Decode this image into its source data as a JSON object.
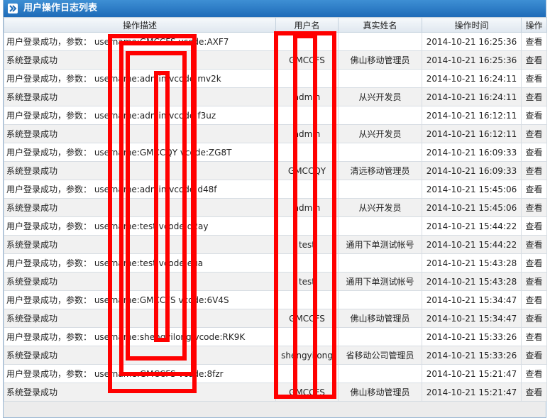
{
  "title": "用户操作日志列表",
  "columns": [
    "操作描述",
    "用户名",
    "真实姓名",
    "操作时间",
    "操作"
  ],
  "rows": [
    {
      "desc": "用户登录成功，参数： username:GMCCFS vcode:AXF7",
      "user": "",
      "name": "",
      "time": "2014-10-21 16:25:36",
      "action": "查看"
    },
    {
      "desc": "系统登录成功",
      "user": "GMCCFS",
      "name": "佛山移动管理员",
      "time": "2014-10-21 16:25:36",
      "action": "查看"
    },
    {
      "desc": "用户登录成功，参数： username:admin vcode:mv2k",
      "user": "",
      "name": "",
      "time": "2014-10-21 16:24:11",
      "action": "查看"
    },
    {
      "desc": "系统登录成功",
      "user": "admin",
      "name": "从兴开发员",
      "time": "2014-10-21 16:24:11",
      "action": "查看"
    },
    {
      "desc": "用户登录成功，参数： username:admin vcode:f3uz",
      "user": "",
      "name": "",
      "time": "2014-10-21 16:12:11",
      "action": "查看"
    },
    {
      "desc": "系统登录成功",
      "user": "admin",
      "name": "从兴开发员",
      "time": "2014-10-21 16:12:11",
      "action": "查看"
    },
    {
      "desc": "用户登录成功，参数： username:GMCCQY vcode:ZG8T",
      "user": "",
      "name": "",
      "time": "2014-10-21 16:09:33",
      "action": "查看"
    },
    {
      "desc": "系统登录成功",
      "user": "GMCCQY",
      "name": "清远移动管理员",
      "time": "2014-10-21 16:09:33",
      "action": "查看"
    },
    {
      "desc": "用户登录成功，参数： username:admin vcode:d48f",
      "user": "",
      "name": "",
      "time": "2014-10-21 15:45:06",
      "action": "查看"
    },
    {
      "desc": "系统登录成功",
      "user": "admin",
      "name": "从兴开发员",
      "time": "2014-10-21 15:45:06",
      "action": "查看"
    },
    {
      "desc": "用户登录成功，参数： username:test vcode:q2ay",
      "user": "",
      "name": "",
      "time": "2014-10-21 15:44:22",
      "action": "查看"
    },
    {
      "desc": "系统登录成功",
      "user": "test",
      "name": "通用下单测试帐号",
      "time": "2014-10-21 15:44:22",
      "action": "查看"
    },
    {
      "desc": "用户登录成功，参数： username:test vcode:eua",
      "user": "",
      "name": "",
      "time": "2014-10-21 15:43:28",
      "action": "查看"
    },
    {
      "desc": "系统登录成功",
      "user": "test",
      "name": "通用下单测试帐号",
      "time": "2014-10-21 15:43:28",
      "action": "查看"
    },
    {
      "desc": "用户登录成功，参数： username:GMCCFS vcode:6V4S",
      "user": "",
      "name": "",
      "time": "2014-10-21 15:34:47",
      "action": "查看"
    },
    {
      "desc": "系统登录成功",
      "user": "GMCCFS",
      "name": "佛山移动管理员",
      "time": "2014-10-21 15:34:47",
      "action": "查看"
    },
    {
      "desc": "用户登录成功，参数： username:shengyilong vcode:RK9K",
      "user": "",
      "name": "",
      "time": "2014-10-21 15:33:26",
      "action": "查看"
    },
    {
      "desc": "系统登录成功",
      "user": "shengyilong",
      "name": "省移动公司管理员",
      "time": "2014-10-21 15:33:26",
      "action": "查看"
    },
    {
      "desc": "用户登录成功，参数： username:GMCCFS vcode:8fzr",
      "user": "",
      "name": "",
      "time": "2014-10-21 15:21:47",
      "action": "查看"
    },
    {
      "desc": "系统登录成功",
      "user": "GMCCFS",
      "name": "佛山移动管理员",
      "time": "2014-10-21 15:21:47",
      "action": "查看"
    }
  ],
  "colors": {
    "titlebar": "#1e6bb8",
    "annotation": "#ff0000"
  },
  "icons": {
    "titlebar": "double-chevron-right-icon"
  }
}
